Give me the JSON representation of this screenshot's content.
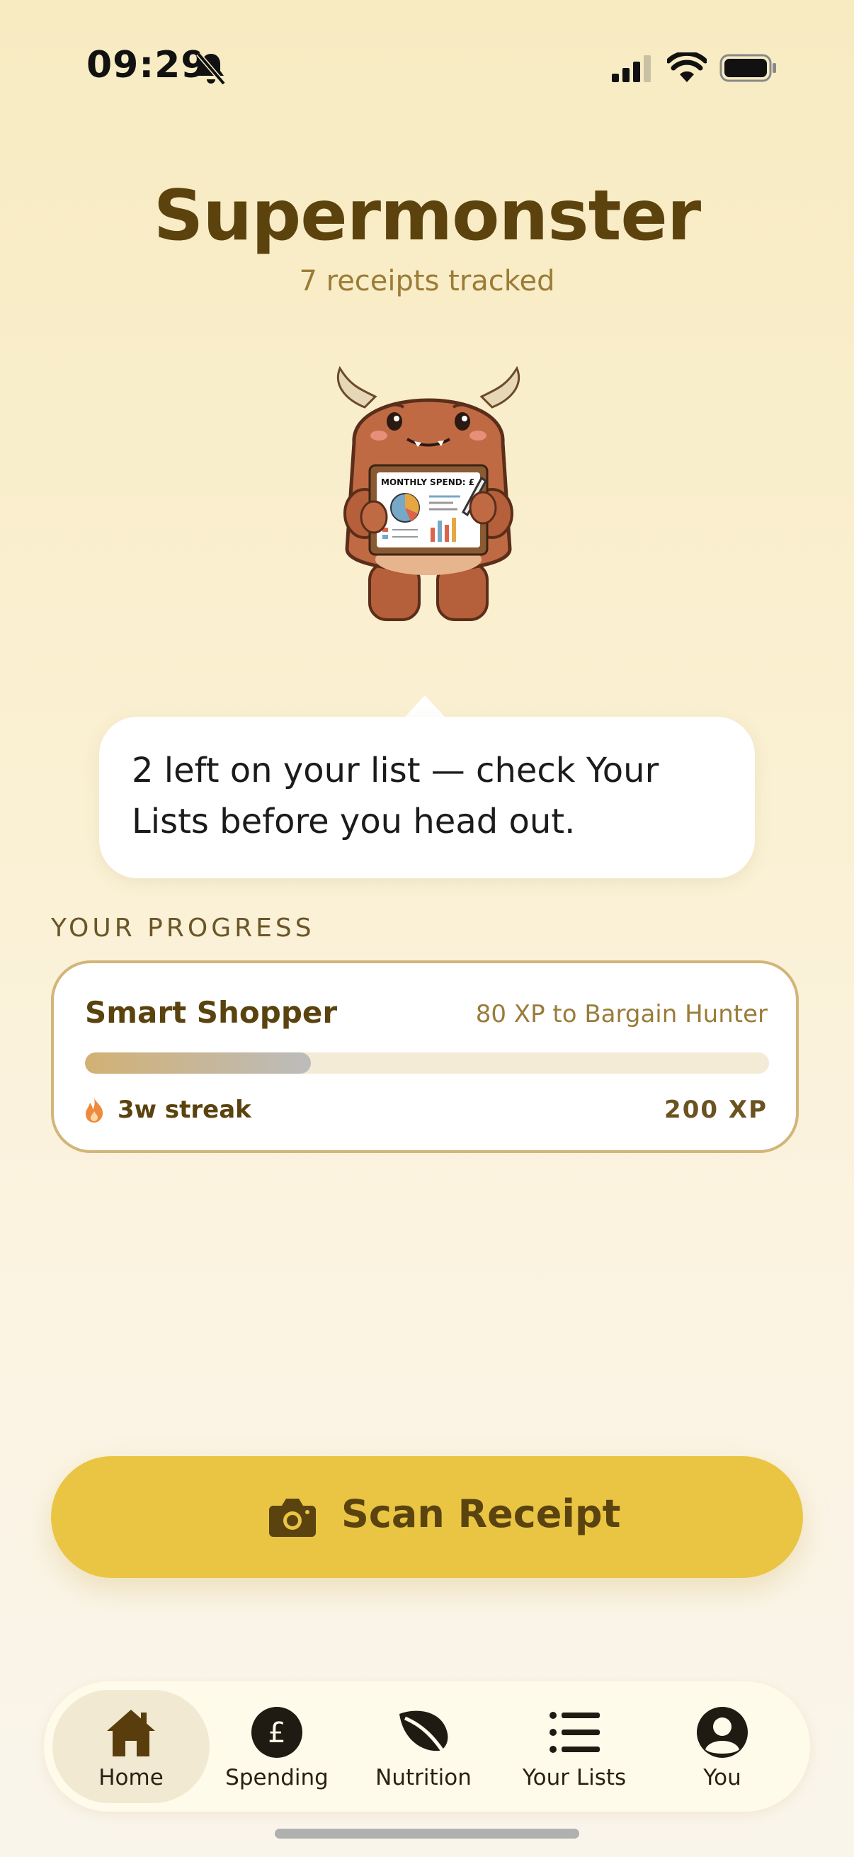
{
  "status_bar": {
    "time": "09:29"
  },
  "header": {
    "title": "Supermonster",
    "subtitle": "7 receipts tracked"
  },
  "mascot": {
    "name": "monster-mascot",
    "board_text": "MONTHLY SPEND: £"
  },
  "bubble": {
    "text": "2 left on your list — check Your Lists before you head out."
  },
  "progress": {
    "heading": "YOUR PROGRESS",
    "level": "Smart Shopper",
    "next_level_text": "80 XP to Bargain Hunter",
    "xp_fraction": 0.33,
    "streak": "3w streak",
    "xp_total": "200 XP"
  },
  "scan_button": {
    "label": "Scan Receipt",
    "icon": "camera-icon"
  },
  "nav": {
    "items": [
      {
        "label": "Home",
        "icon": "home-icon",
        "active": true
      },
      {
        "label": "Spending",
        "icon": "pound-icon",
        "active": false
      },
      {
        "label": "Nutrition",
        "icon": "leaf-icon",
        "active": false
      },
      {
        "label": "Your Lists",
        "icon": "list-icon",
        "active": false
      },
      {
        "label": "You",
        "icon": "user-icon",
        "active": false
      }
    ]
  },
  "colors": {
    "accent": "#e9c543",
    "text_brown": "#5a430f",
    "muted_brown": "#9b7c37",
    "card_border": "#d2b57a"
  }
}
